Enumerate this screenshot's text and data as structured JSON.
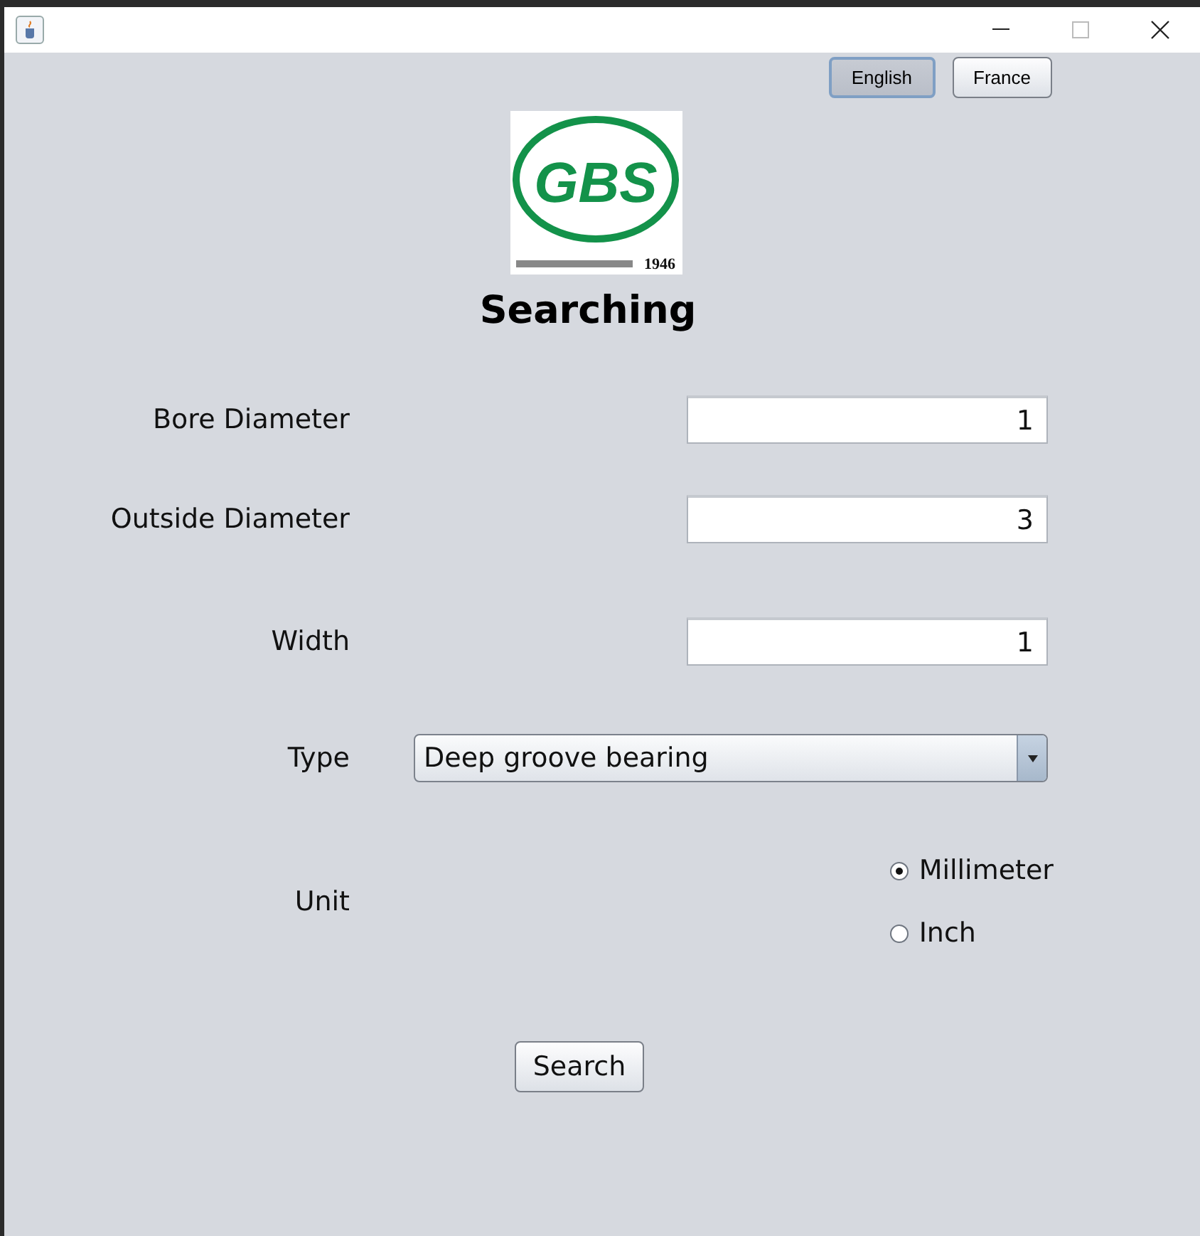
{
  "languages": [
    {
      "label": "English",
      "selected": true
    },
    {
      "label": "France",
      "selected": false
    }
  ],
  "logo": {
    "letters": "GBS",
    "year": "1946"
  },
  "title": "Searching",
  "fields": [
    {
      "label": "Bore Diameter",
      "value": "1"
    },
    {
      "label": "Outside Diameter",
      "value": "3"
    },
    {
      "label": "Width",
      "value": "1"
    }
  ],
  "type": {
    "label": "Type",
    "value": "Deep groove bearing"
  },
  "unit": {
    "label": "Unit",
    "options": [
      {
        "label": "Millimeter",
        "selected": true
      },
      {
        "label": "Inch",
        "selected": false
      }
    ]
  },
  "search_button": "Search"
}
